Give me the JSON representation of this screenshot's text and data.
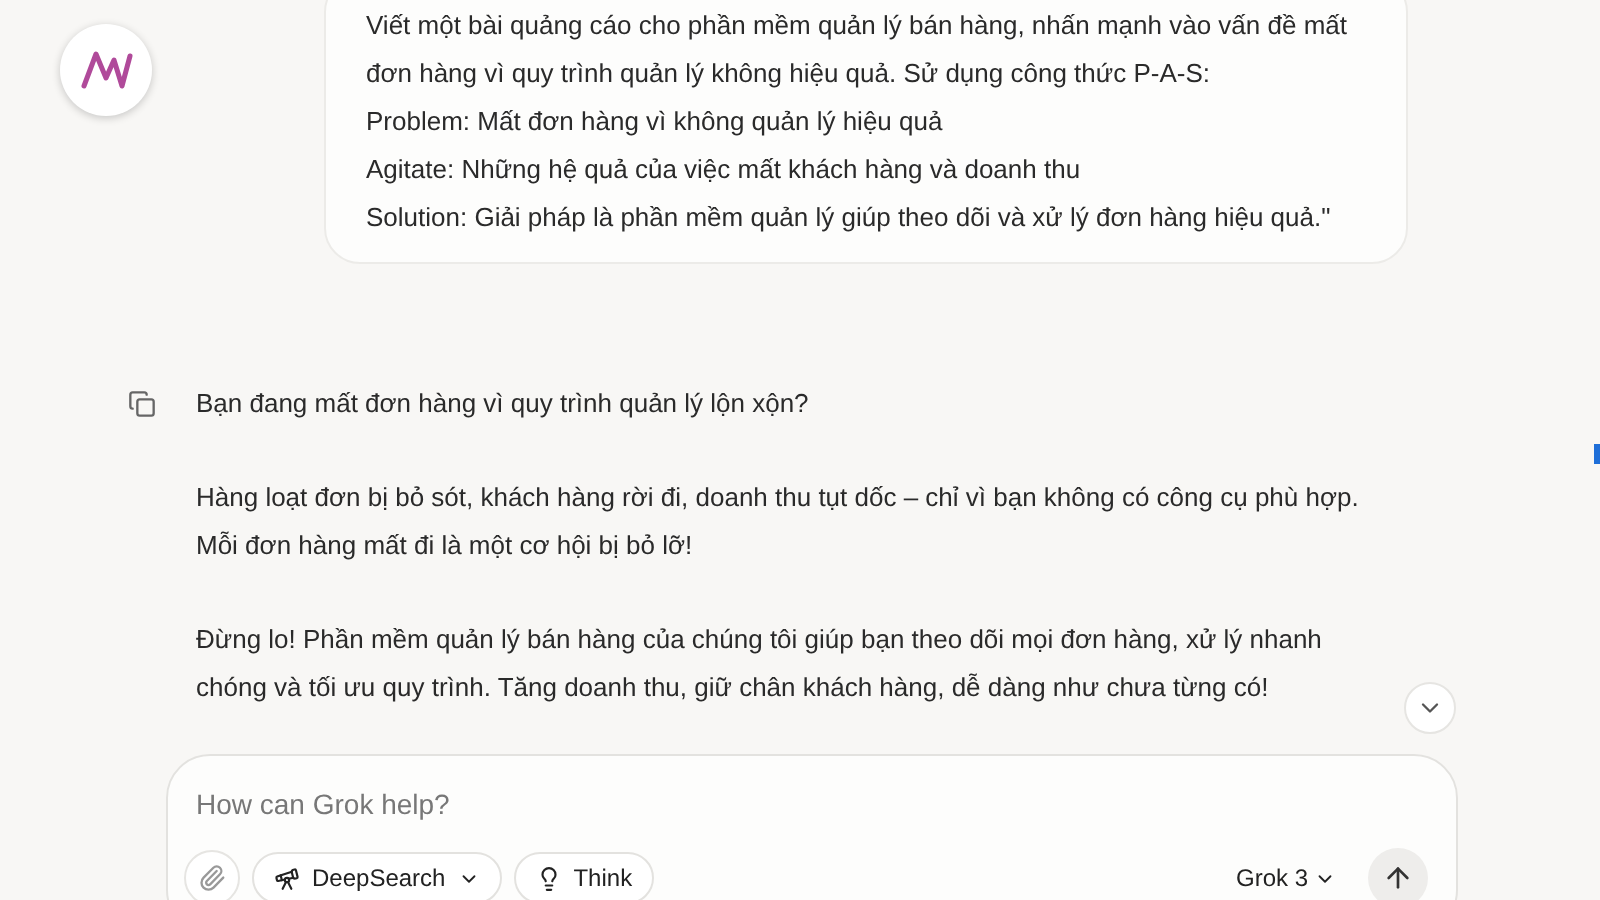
{
  "user_message": {
    "lines": [
      "Viết một bài quảng cáo cho phần mềm quản lý bán hàng, nhấn mạnh vào vấn đề mất đơn hàng vì quy trình quản lý không hiệu quả. Sử dụng công thức P-A-S:",
      "Problem: Mất đơn hàng vì không quản lý hiệu quả",
      "Agitate: Những hệ quả của việc mất khách hàng và doanh thu",
      "Solution: Giải pháp là phần mềm quản lý giúp theo dõi và xử lý đơn hàng hiệu quả.\""
    ]
  },
  "response": {
    "paragraphs": [
      "Bạn đang mất đơn hàng vì quy trình quản lý lộn xộn?",
      "Hàng loạt đơn bị bỏ sót, khách hàng rời đi, doanh thu tụt dốc – chỉ vì bạn không có công cụ phù hợp. Mỗi đơn hàng mất đi là một cơ hội bị bỏ lỡ!",
      "Đừng lo! Phần mềm quản lý bán hàng của chúng tôi giúp bạn theo dõi mọi đơn hàng, xử lý nhanh chóng và tối ưu quy trình. Tăng doanh thu, giữ chân khách hàng, dễ dàng như chưa từng có!"
    ]
  },
  "composer": {
    "placeholder": "How can Grok help?",
    "deepsearch": "DeepSearch",
    "think": "Think",
    "model": "Grok 3"
  }
}
